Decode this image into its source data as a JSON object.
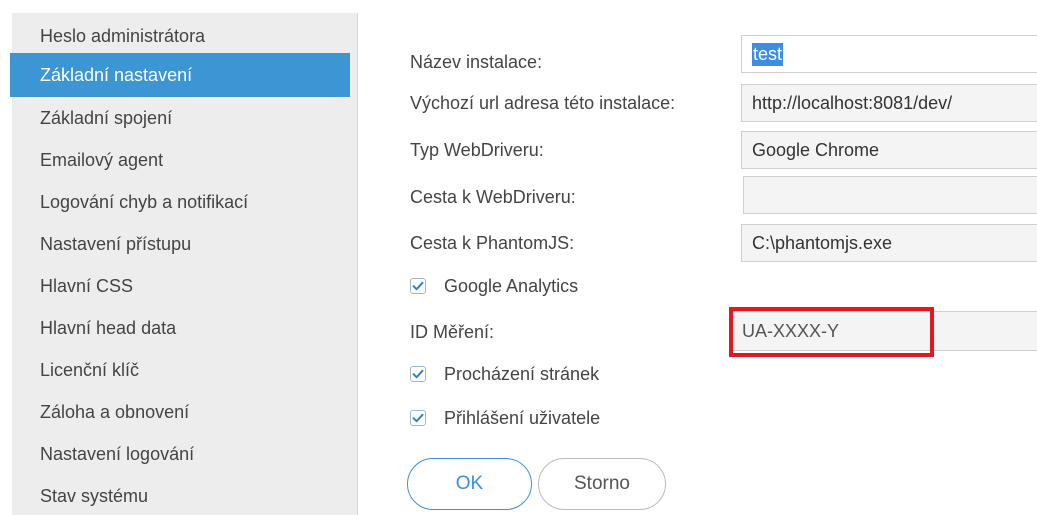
{
  "sidebar": {
    "items": [
      {
        "label": "Heslo administrátora",
        "active": false
      },
      {
        "label": "Základní nastavení",
        "active": true
      },
      {
        "label": "Základní spojení",
        "active": false
      },
      {
        "label": "Emailový agent",
        "active": false
      },
      {
        "label": "Logování chyb a notifikací",
        "active": false
      },
      {
        "label": "Nastavení přístupu",
        "active": false
      },
      {
        "label": "Hlavní CSS",
        "active": false
      },
      {
        "label": "Hlavní head data",
        "active": false
      },
      {
        "label": "Licenční klíč",
        "active": false
      },
      {
        "label": "Záloha a obnovení",
        "active": false
      },
      {
        "label": "Nastavení logování",
        "active": false
      },
      {
        "label": "Stav systému",
        "active": false
      }
    ]
  },
  "form": {
    "install_name": {
      "label": "Název instalace:",
      "value": "test"
    },
    "default_url": {
      "label": "Výchozí url adresa této instalace:",
      "value": "http://localhost:8081/dev/"
    },
    "webdriver_type": {
      "label": "Typ WebDriveru:",
      "value": "Google Chrome"
    },
    "webdriver_path": {
      "label": "Cesta k WebDriveru:",
      "value": ""
    },
    "phantomjs_path": {
      "label": "Cesta k PhantomJS:",
      "value": "C:\\phantomjs.exe"
    },
    "google_analytics": {
      "label": "Google Analytics",
      "checked": true
    },
    "measurement_id": {
      "label": "ID Měření:",
      "value": "UA-XXXX-Y"
    },
    "page_browsing": {
      "label": "Procházení stránek",
      "checked": true
    },
    "user_login": {
      "label": "Přihlášení uživatele",
      "checked": true
    }
  },
  "buttons": {
    "ok": "OK",
    "cancel": "Storno"
  },
  "colors": {
    "accent": "#3d96d4",
    "highlight": "#e3171f",
    "sidebar_bg": "#ededed"
  }
}
